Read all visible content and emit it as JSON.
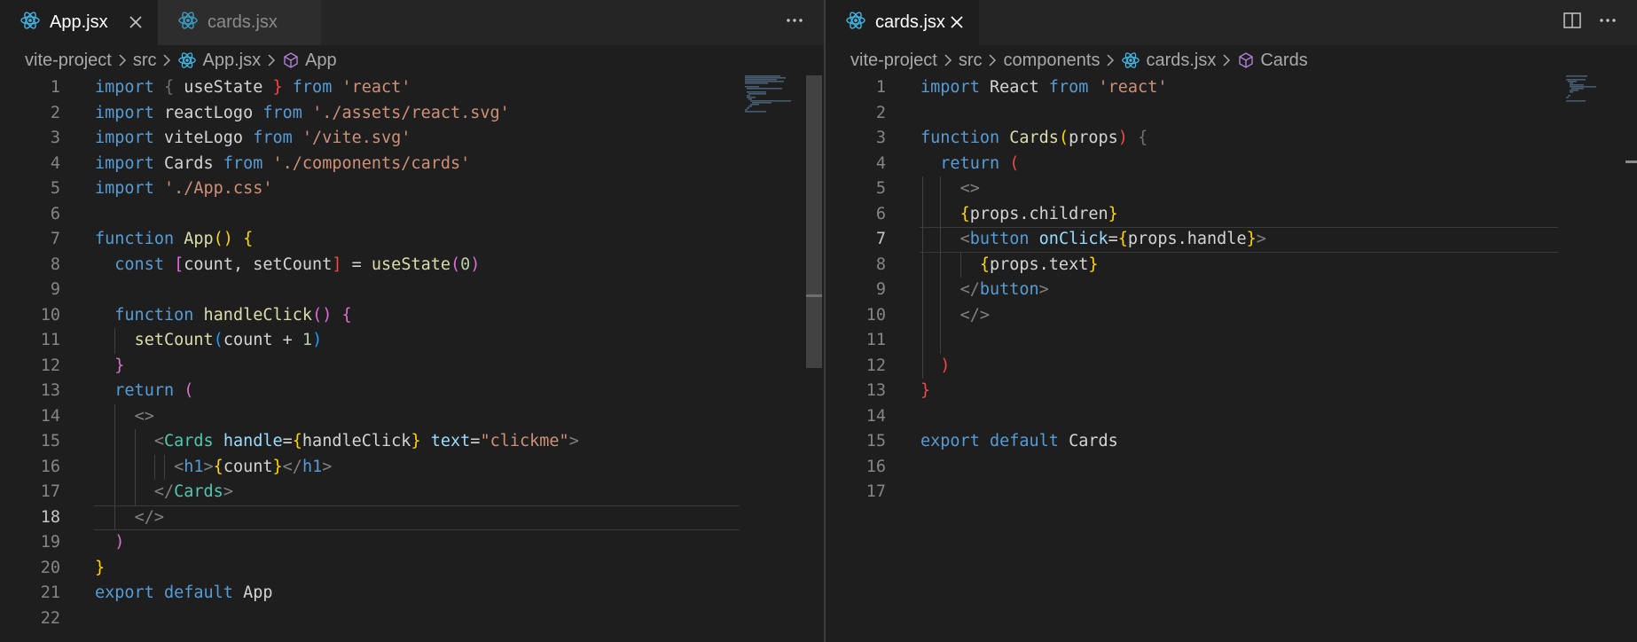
{
  "colors": {
    "accent": "#007acc",
    "react_icon": "#3fb7e6",
    "component_icon": "#b180d7"
  },
  "left": {
    "tabs": [
      {
        "label": "App.jsx",
        "icon": "react-icon",
        "active": true
      },
      {
        "label": "cards.jsx",
        "icon": "react-icon",
        "active": false
      }
    ],
    "actions": {
      "more": "···"
    },
    "breadcrumb": [
      "vite-project",
      "src",
      "App.jsx",
      "App"
    ],
    "current_line": 18,
    "lines": [
      [
        [
          "import",
          "kw"
        ],
        [
          " ",
          "id"
        ],
        [
          "{",
          "dimb"
        ],
        [
          " useState ",
          "id"
        ],
        [
          "}",
          "br"
        ],
        [
          " ",
          "id"
        ],
        [
          "from",
          "kw"
        ],
        [
          " ",
          "id"
        ],
        [
          "'react'",
          "str"
        ]
      ],
      [
        [
          "import",
          "kw"
        ],
        [
          " reactLogo ",
          "id"
        ],
        [
          "from",
          "kwc"
        ],
        [
          " ",
          "id"
        ],
        [
          "'./assets/react.svg'",
          "str"
        ]
      ],
      [
        [
          "import",
          "kw"
        ],
        [
          " viteLogo ",
          "id"
        ],
        [
          "from",
          "kwc"
        ],
        [
          " ",
          "id"
        ],
        [
          "'/vite.svg'",
          "str"
        ]
      ],
      [
        [
          "import",
          "kw"
        ],
        [
          " Cards ",
          "id"
        ],
        [
          "from",
          "kw"
        ],
        [
          " ",
          "id"
        ],
        [
          "'./components/cards'",
          "str"
        ]
      ],
      [
        [
          "import",
          "kw"
        ],
        [
          " ",
          "id"
        ],
        [
          "'./App.css'",
          "str"
        ]
      ],
      [],
      [
        [
          "function",
          "kw"
        ],
        [
          " ",
          "id"
        ],
        [
          "App",
          "fn"
        ],
        [
          "()",
          "b1"
        ],
        [
          " ",
          "id"
        ],
        [
          "{",
          "b1"
        ]
      ],
      [
        [
          "  ",
          "id"
        ],
        [
          "const",
          "kw"
        ],
        [
          " ",
          "id"
        ],
        [
          "[",
          "b2"
        ],
        [
          "count, setCount",
          "id"
        ],
        [
          "]",
          "br"
        ],
        [
          " = ",
          "id"
        ],
        [
          "useState",
          "fn"
        ],
        [
          "(",
          "b2"
        ],
        [
          "0",
          "num"
        ],
        [
          ")",
          "b2"
        ]
      ],
      [],
      [
        [
          "  ",
          "id"
        ],
        [
          "function",
          "kw"
        ],
        [
          " ",
          "id"
        ],
        [
          "handleClick",
          "fn"
        ],
        [
          "()",
          "b2"
        ],
        [
          " ",
          "id"
        ],
        [
          "{",
          "b2"
        ]
      ],
      [
        [
          "    ",
          "id"
        ],
        [
          "setCount",
          "fn"
        ],
        [
          "(",
          "b3"
        ],
        [
          "count + ",
          "id"
        ],
        [
          "1",
          "num"
        ],
        [
          ")",
          "b3"
        ]
      ],
      [
        [
          "  ",
          "id"
        ],
        [
          "}",
          "b2"
        ]
      ],
      [
        [
          "  ",
          "id"
        ],
        [
          "return",
          "kw"
        ],
        [
          " ",
          "id"
        ],
        [
          "(",
          "b2"
        ]
      ],
      [
        [
          "    ",
          "id"
        ],
        [
          "<>",
          "tagc"
        ]
      ],
      [
        [
          "      ",
          "id"
        ],
        [
          "<",
          "tagc"
        ],
        [
          "Cards",
          "comp"
        ],
        [
          " ",
          "id"
        ],
        [
          "handle",
          "var"
        ],
        [
          "=",
          "pun"
        ],
        [
          "{",
          "b1"
        ],
        [
          "handleClick",
          "id"
        ],
        [
          "}",
          "b1"
        ],
        [
          " ",
          "id"
        ],
        [
          "text",
          "var"
        ],
        [
          "=",
          "pun"
        ],
        [
          "\"clickme\"",
          "str"
        ],
        [
          ">",
          "tagc"
        ]
      ],
      [
        [
          "        ",
          "id"
        ],
        [
          "<",
          "tagc"
        ],
        [
          "h1",
          "tagn"
        ],
        [
          ">",
          "tagc"
        ],
        [
          "{",
          "b1"
        ],
        [
          "count",
          "id"
        ],
        [
          "}",
          "b1"
        ],
        [
          "</",
          "tagc"
        ],
        [
          "h1",
          "tagn"
        ],
        [
          ">",
          "tagc"
        ]
      ],
      [
        [
          "      ",
          "id"
        ],
        [
          "</",
          "tagc"
        ],
        [
          "Cards",
          "comp"
        ],
        [
          ">",
          "tagc"
        ]
      ],
      [
        [
          "    ",
          "id"
        ],
        [
          "</>",
          "tagc"
        ]
      ],
      [
        [
          "  ",
          "id"
        ],
        [
          ")",
          "b2"
        ]
      ],
      [
        [
          "}",
          "b1"
        ]
      ],
      [
        [
          "export",
          "kw"
        ],
        [
          " ",
          "id"
        ],
        [
          "default",
          "kw"
        ],
        [
          " App",
          "id"
        ]
      ],
      []
    ]
  },
  "right": {
    "tabs": [
      {
        "label": "cards.jsx",
        "icon": "react-icon",
        "active": true
      }
    ],
    "actions": {
      "more": "···"
    },
    "breadcrumb": [
      "vite-project",
      "src",
      "components",
      "cards.jsx",
      "Cards"
    ],
    "current_line": 7,
    "lines": [
      [
        [
          "import",
          "kw"
        ],
        [
          " React ",
          "id"
        ],
        [
          "from",
          "kw"
        ],
        [
          " ",
          "id"
        ],
        [
          "'react'",
          "str"
        ]
      ],
      [],
      [
        [
          "function",
          "kw"
        ],
        [
          " ",
          "id"
        ],
        [
          "Cards",
          "fn"
        ],
        [
          "(",
          "b1"
        ],
        [
          "props",
          "id"
        ],
        [
          ")",
          "br"
        ],
        [
          " ",
          "id"
        ],
        [
          "{",
          "dimb"
        ]
      ],
      [
        [
          "  ",
          "id"
        ],
        [
          "return",
          "kw"
        ],
        [
          " ",
          "id"
        ],
        [
          "(",
          "br"
        ]
      ],
      [
        [
          "    ",
          "id"
        ],
        [
          "<>",
          "tagc"
        ]
      ],
      [
        [
          "    ",
          "id"
        ],
        [
          "{",
          "b1"
        ],
        [
          "props.children",
          "id"
        ],
        [
          "}",
          "b1"
        ]
      ],
      [
        [
          "    ",
          "id"
        ],
        [
          "<",
          "tagc"
        ],
        [
          "button",
          "tagn"
        ],
        [
          " ",
          "id"
        ],
        [
          "onClick",
          "var"
        ],
        [
          "=",
          "pun"
        ],
        [
          "{",
          "b1"
        ],
        [
          "props.handle",
          "id"
        ],
        [
          "}",
          "b1"
        ],
        [
          ">",
          "tagc"
        ]
      ],
      [
        [
          "      ",
          "id"
        ],
        [
          "{",
          "b1"
        ],
        [
          "props.text",
          "id"
        ],
        [
          "}",
          "b1"
        ]
      ],
      [
        [
          "    ",
          "id"
        ],
        [
          "</",
          "tagc"
        ],
        [
          "button",
          "tagn"
        ],
        [
          ">",
          "tagc"
        ]
      ],
      [
        [
          "    ",
          "id"
        ],
        [
          "</>",
          "tagc"
        ]
      ],
      [],
      [
        [
          "  ",
          "id"
        ],
        [
          ")",
          "br"
        ]
      ],
      [
        [
          "}",
          "br"
        ]
      ],
      [],
      [
        [
          "export",
          "kw"
        ],
        [
          " ",
          "id"
        ],
        [
          "default",
          "kw"
        ],
        [
          " Cards",
          "id"
        ]
      ],
      [],
      []
    ]
  }
}
